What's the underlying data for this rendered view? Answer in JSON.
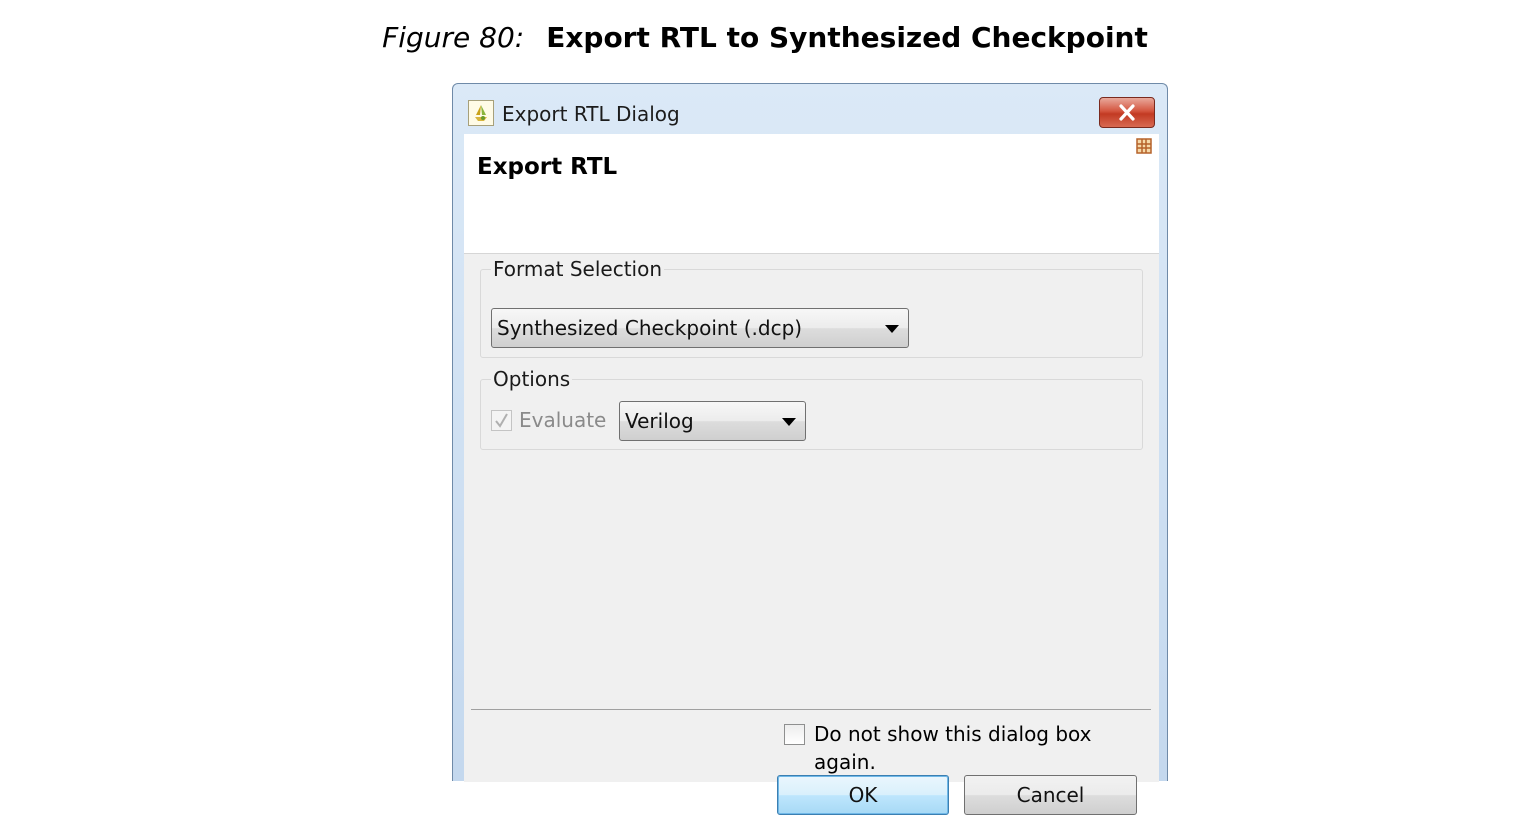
{
  "caption": {
    "figure_label": "Figure 80:",
    "figure_title": "Export RTL to Synthesized Checkpoint"
  },
  "window": {
    "title": "Export RTL Dialog",
    "app_icon": "vivado-hls-icon",
    "close_icon": "close-icon",
    "title_bar_gradient": "#c4d8ee"
  },
  "banner": {
    "title": "Export RTL",
    "corner_icon": "grid-icon"
  },
  "format_selection": {
    "legend": "Format Selection",
    "selected_format": "Synthesized Checkpoint (.dcp)"
  },
  "options": {
    "legend": "Options",
    "evaluate_label": "Evaluate",
    "evaluate_checked": true,
    "evaluate_enabled": false,
    "language_selected": "Verilog"
  },
  "footer": {
    "dont_show_label": "Do not show this dialog box again.",
    "dont_show_checked": false,
    "ok_label": "OK",
    "cancel_label": "Cancel"
  },
  "colors": {
    "client_background": "#f0f0f0",
    "close_button": "#c23a23",
    "ok_button_border": "#3c7fb1"
  }
}
